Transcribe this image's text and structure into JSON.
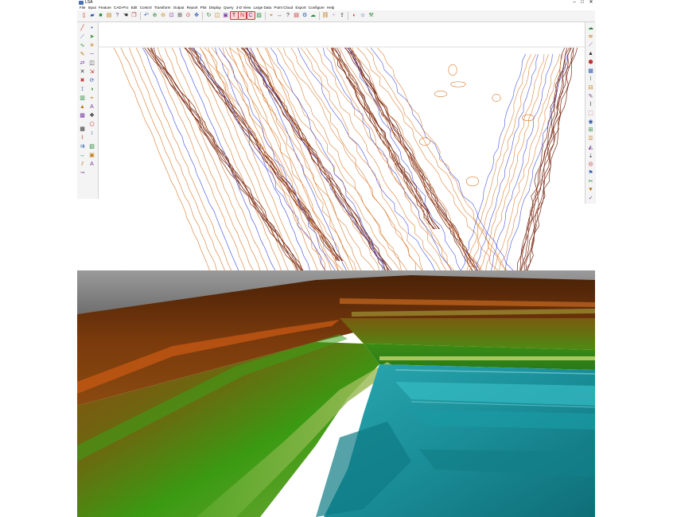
{
  "window": {
    "title": "LSA",
    "minimize": "–",
    "maximize": "□",
    "close": "✕"
  },
  "menu": [
    "File",
    "Input",
    "Feature",
    "CAD-Pro",
    "Edit",
    "Control",
    "Transform",
    "Output",
    "Report",
    "Plot",
    "Display",
    "Query",
    "3-D View",
    "Large Data",
    "Point Cloud",
    "Export",
    "Configure",
    "Help"
  ],
  "colors": {
    "contour_brown": "#7a2a14",
    "contour_orange": "#d8782a",
    "contour_blue": "#3a46d8",
    "terrain_high": "#5c2a0a",
    "terrain_mid": "#3c9c10",
    "terrain_low": "#1e9aa4"
  },
  "icons": {
    "toolbar": [
      "new-file-icon",
      "open-file-icon",
      "save-icon",
      "print-icon",
      "help-icon",
      "hand-icon",
      "copy-icon",
      "undo-icon",
      "zoom-in-icon",
      "zoom-out-icon",
      "zoom-window-icon",
      "zoom-extents-icon",
      "zoom-previous-icon",
      "pan-icon",
      "redraw-icon",
      "layer-icon",
      "display-icon",
      "text-mode-icon",
      "north-icon",
      "curve-mode-icon",
      "image-icon",
      "snap-icon",
      "measure-icon",
      "query-icon",
      "report-icon",
      "settings-icon",
      "surface-icon",
      "link-icon",
      "point-cloud-icon",
      "export-icon",
      "color-icon",
      "user-icon",
      "tools-icon"
    ],
    "left_col1": [
      "draw-line-icon",
      "draw-polyline-icon",
      "draw-curve-icon",
      "edit-point-icon",
      "inverse-icon",
      "intersect-icon",
      "delete-icon",
      "traverse-icon",
      "chart-icon",
      "triangle-icon",
      "image-layer-icon",
      "grid-icon",
      "profile-icon",
      "offset-icon",
      "measure-icon",
      "road-icon",
      "station-icon"
    ],
    "left_col2": [
      "point-icon",
      "arrow-icon",
      "node-icon",
      "line-icon",
      "layer-icon",
      "scale-icon",
      "rotate-icon",
      "shade-icon",
      "snap-icon",
      "text-icon",
      "symbol-icon",
      "polygon-icon",
      "dimension-icon",
      "hatch-icon",
      "block-icon",
      "text-icon"
    ],
    "right_col": [
      "surface-icon",
      "contour-icon",
      "slope-icon",
      "triangle-icon",
      "volume-icon",
      "grid-icon",
      "profile-icon",
      "section-icon",
      "label-icon",
      "break-line-icon",
      "boundary-icon",
      "spot-icon",
      "mesh-icon",
      "drape-icon",
      "tin-icon",
      "drain-icon",
      "view-icon",
      "flag-icon",
      "cut-icon",
      "fill-icon",
      "check-icon"
    ]
  }
}
